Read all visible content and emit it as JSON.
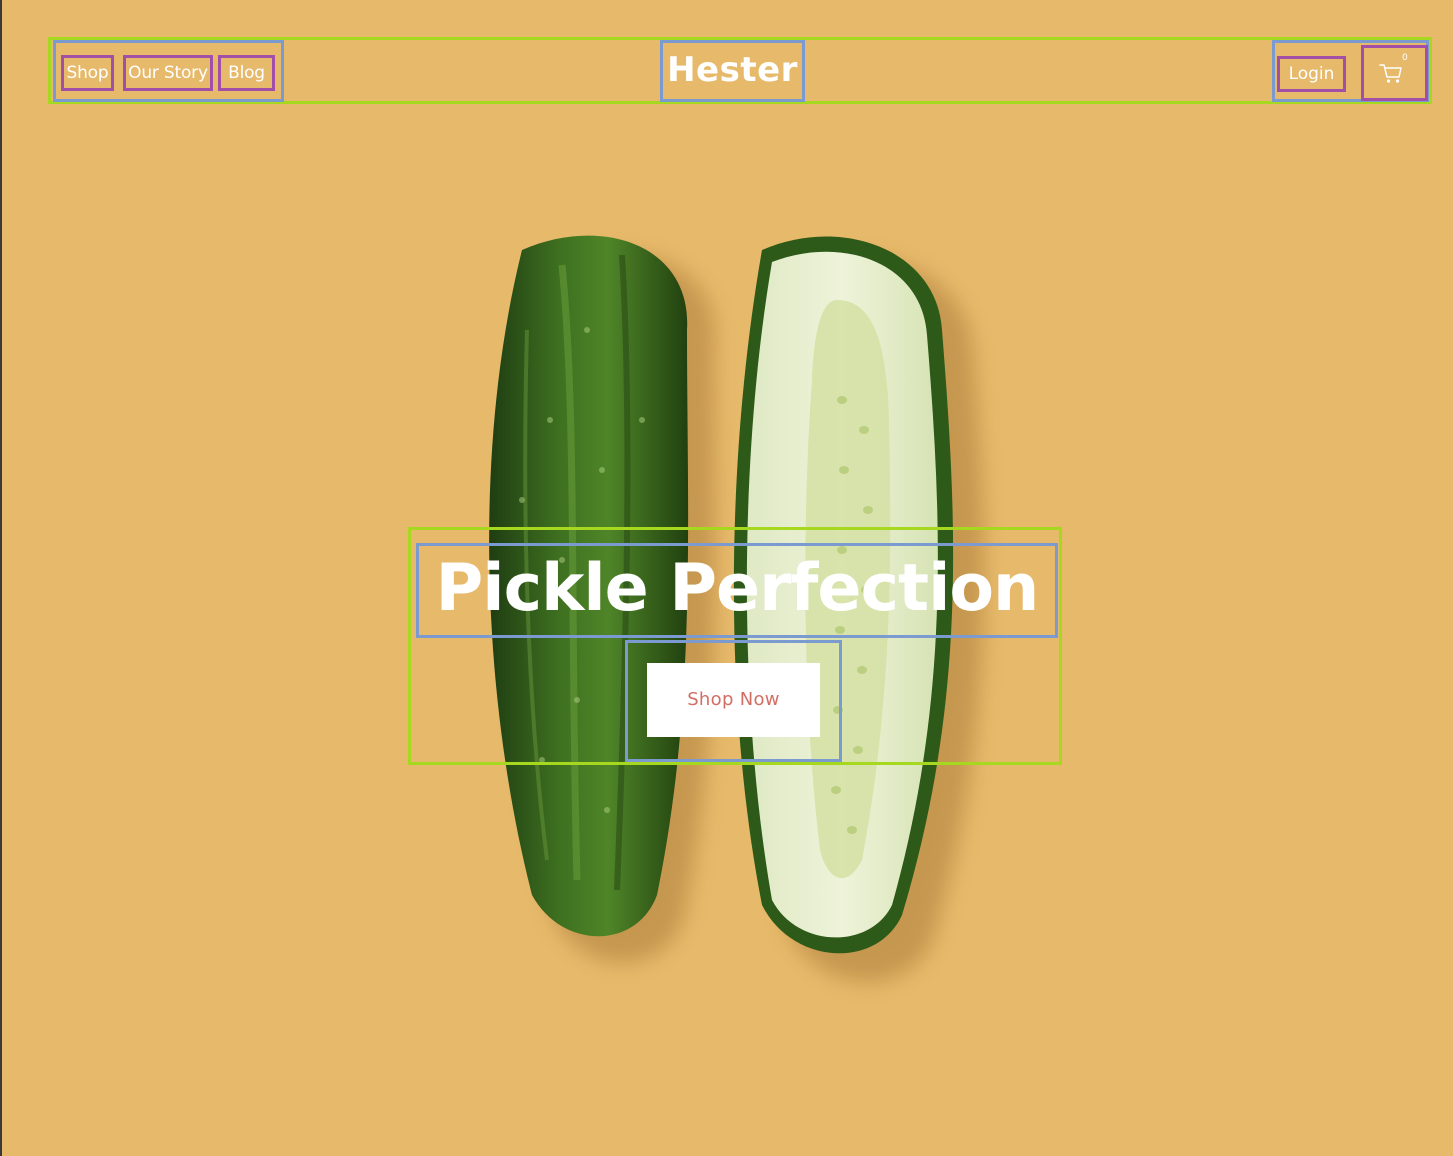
{
  "header": {
    "nav_left": [
      {
        "label": "Shop"
      },
      {
        "label": "Our Story"
      },
      {
        "label": "Blog"
      }
    ],
    "brand": "Hester",
    "login_label": "Login",
    "cart": {
      "icon": "cart-icon",
      "count": "0"
    }
  },
  "hero": {
    "title": "Pickle Perfection",
    "cta_label": "Shop Now",
    "background_image": "photo of two pickles on a yellow background, one whole and one sliced"
  },
  "colors": {
    "background": "#e7b96b",
    "text": "#ffffff",
    "cta_text": "#d26e63",
    "cta_background": "#ffffff"
  }
}
